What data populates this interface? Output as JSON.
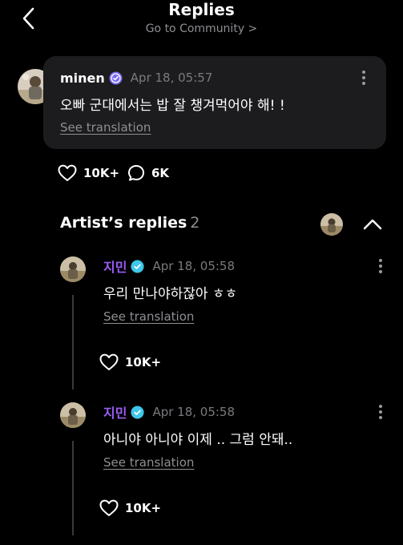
{
  "header": {
    "title": "Replies",
    "subtitle": "Go to Community >"
  },
  "comment": {
    "author": "minen",
    "time": "Apr 18, 05:57",
    "text": "오빠 군대에서는 밥 잘 챙겨먹어야 해! !",
    "translate_label": "See translation",
    "likes": "10K+",
    "replies": "6K"
  },
  "artist_replies": {
    "title": "Artist’s replies",
    "count": "2",
    "items": [
      {
        "author": "지민",
        "time": "Apr 18, 05:58",
        "text": "우리 만나야하잖아 ㅎㅎ",
        "translate_label": "See translation",
        "likes": "10K+"
      },
      {
        "author": "지민",
        "time": "Apr 18, 05:58",
        "text": "아니야 아니야 이제 .. 그럼 안돼..",
        "translate_label": "See translation",
        "likes": "10K+"
      }
    ]
  },
  "colors": {
    "background": "#000000",
    "card": "#1c1c1e",
    "artist_name": "#9b5cf6",
    "verified_fan": "#7b6cf6",
    "verified_artist": "#3ec7e8",
    "muted_text": "#8e8e93"
  },
  "icons": [
    "back-arrow-icon",
    "chevron-right-icon",
    "verified-badge-icon",
    "more-vertical-icon",
    "heart-icon",
    "comment-bubble-icon",
    "chevron-up-icon"
  ]
}
